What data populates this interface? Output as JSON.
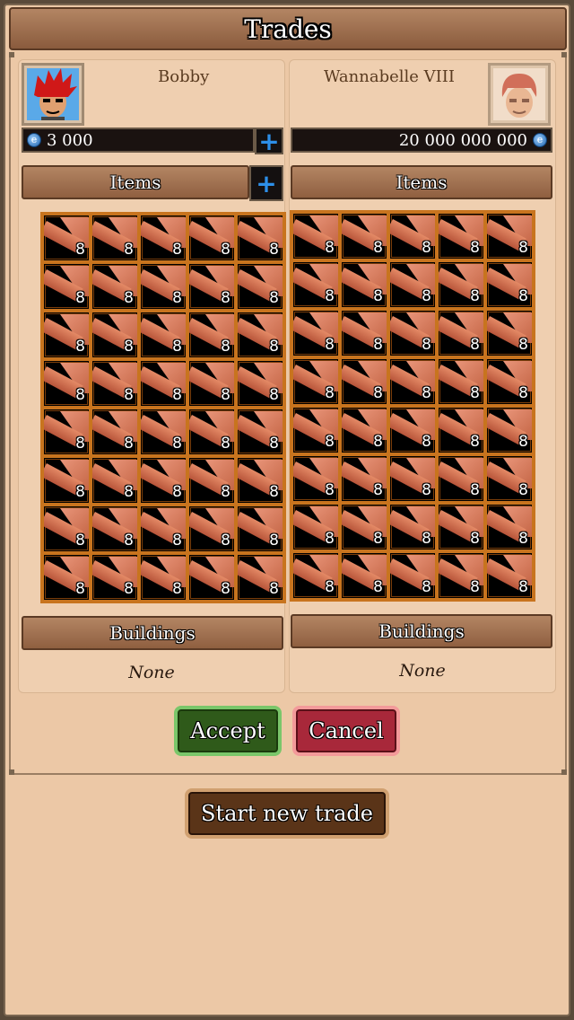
{
  "window": {
    "title": "Trades"
  },
  "left_player": {
    "name": "Bobby",
    "money": "3 000",
    "items_label": "Items",
    "buildings_label": "Buildings",
    "buildings_value": "None",
    "item_slots": [
      "8",
      "8",
      "8",
      "8",
      "8",
      "8",
      "8",
      "8",
      "8",
      "8",
      "8",
      "8",
      "8",
      "8",
      "8",
      "8",
      "8",
      "8",
      "8",
      "8",
      "8",
      "8",
      "8",
      "8",
      "8",
      "8",
      "8",
      "8",
      "8",
      "8",
      "8",
      "8",
      "8",
      "8",
      "8",
      "8",
      "8",
      "8",
      "8",
      "8"
    ]
  },
  "right_player": {
    "name": "Wannabelle VIII",
    "money": "20 000 000 000",
    "items_label": "Items",
    "buildings_label": "Buildings",
    "buildings_value": "None",
    "item_slots": [
      "8",
      "8",
      "8",
      "8",
      "8",
      "8",
      "8",
      "8",
      "8",
      "8",
      "8",
      "8",
      "8",
      "8",
      "8",
      "8",
      "8",
      "8",
      "8",
      "8",
      "8",
      "8",
      "8",
      "8",
      "8",
      "8",
      "8",
      "8",
      "8",
      "8",
      "8",
      "8",
      "8",
      "8",
      "8",
      "8",
      "8",
      "8",
      "8",
      "8"
    ]
  },
  "actions": {
    "accept_label": "Accept",
    "cancel_label": "Cancel",
    "new_trade_label": "Start new trade"
  },
  "icons": {
    "add": "plus-icon",
    "currency": "coin-icon",
    "item": "wood-plank-icon"
  },
  "colors": {
    "accept": "#2f5a1a",
    "cancel": "#a8283a",
    "slot_border": "#c8741e",
    "plus": "#2d8fe8"
  }
}
